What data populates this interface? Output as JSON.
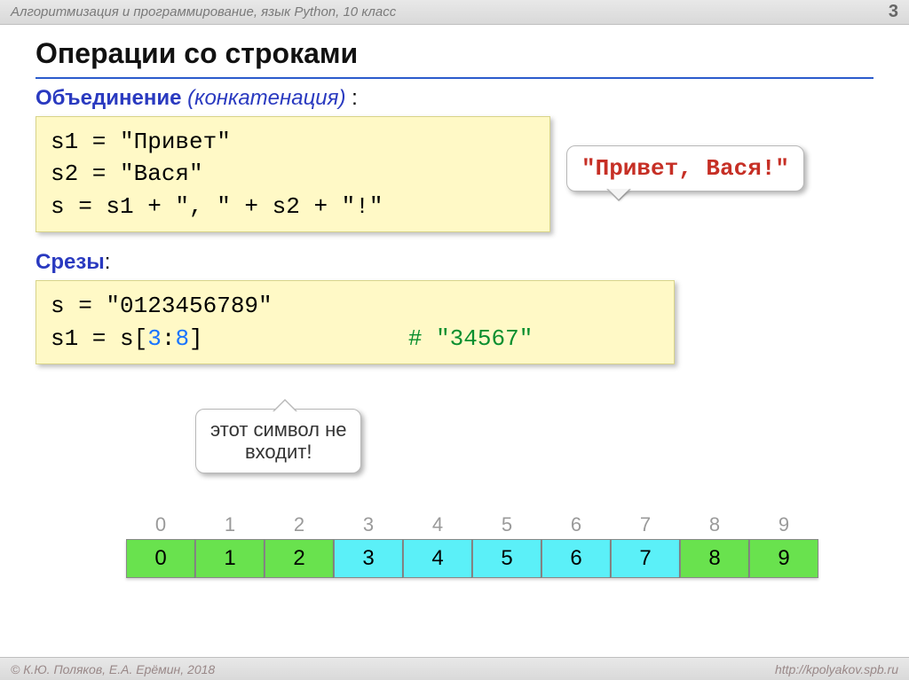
{
  "header": {
    "breadcrumb": "Алгоритмизация и программирование, язык Python, 10 класс",
    "page_number": "3"
  },
  "title": "Операции со строками",
  "concat": {
    "label_bold": "Объединение",
    "label_italic": "(конкатенация)",
    "label_suffix": " :",
    "code_line1": "s1 = \"Привет\"",
    "code_line2": "s2 = \"Вася\"",
    "code_line3": "s  = s1 + \", \" + s2 + \"!\"",
    "result": "\"Привет, Вася!\""
  },
  "slice": {
    "label_bold": "Срезы",
    "label_suffix": ":",
    "code_line1": "s = \"0123456789\"",
    "code_line2_pre": "s1 = s[",
    "code_line2_a": "3",
    "code_line2_mid": ":",
    "code_line2_b": "8",
    "code_line2_post": "]",
    "comment": "# \"34567\"",
    "callout_l1": "этот символ не",
    "callout_l2": "входит!"
  },
  "table": {
    "indices": [
      "0",
      "1",
      "2",
      "3",
      "4",
      "5",
      "6",
      "7",
      "8",
      "9"
    ],
    "values": [
      "0",
      "1",
      "2",
      "3",
      "4",
      "5",
      "6",
      "7",
      "8",
      "9"
    ],
    "highlight_start": 3,
    "highlight_end": 7
  },
  "footer": {
    "left": "© К.Ю. Поляков, Е.А. Ерёмин, 2018",
    "right": "http://kpolyakov.spb.ru"
  }
}
